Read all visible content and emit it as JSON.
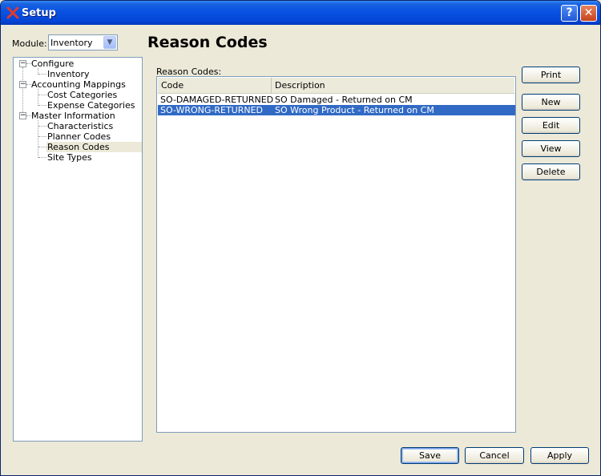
{
  "window": {
    "title": "Setup"
  },
  "module": {
    "label": "Module:",
    "value": "Inventory"
  },
  "tree": {
    "items": [
      {
        "label": "Configure",
        "expander": "−"
      },
      {
        "label": "Inventory"
      },
      {
        "label": "Accounting Mappings",
        "expander": "−"
      },
      {
        "label": "Cost Categories"
      },
      {
        "label": "Expense Categories"
      },
      {
        "label": "Master Information",
        "expander": "−"
      },
      {
        "label": "Characteristics"
      },
      {
        "label": "Planner Codes"
      },
      {
        "label": "Reason Codes"
      },
      {
        "label": "Site Types"
      }
    ]
  },
  "main": {
    "heading": "Reason Codes",
    "list_label": "Reason Codes:",
    "columns": [
      "Code",
      "Description"
    ],
    "rows": [
      {
        "code": "SO-DAMAGED-RETURNED",
        "description": "SO Damaged - Returned on CM"
      },
      {
        "code": "SO-WRONG-RETURNED",
        "description": "SO Wrong Product -  Returned on CM"
      }
    ]
  },
  "buttons": {
    "print": "Print",
    "new": "New",
    "edit": "Edit",
    "view": "View",
    "delete": "Delete",
    "save": "Save",
    "cancel": "Cancel",
    "apply": "Apply"
  },
  "colors": {
    "titlebar": "#0445d6",
    "selection": "#316ac5",
    "face": "#ece9d8"
  }
}
